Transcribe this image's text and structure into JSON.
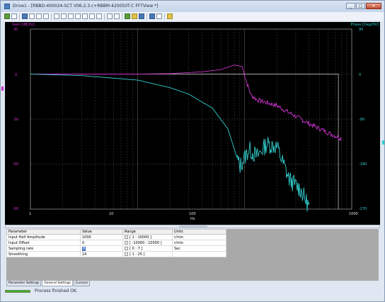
{
  "window": {
    "title": "Drive1 - [RBBD-400024-SCT V06.2.3.c+RBBM-420050T-C FFTView *]",
    "controls": [
      "_",
      "□",
      "✕"
    ]
  },
  "toolbar": {
    "icons": [
      "filter-icon",
      "filter-clear-icon",
      "save-icon",
      "new-icon",
      "copy-icon",
      "paste-icon",
      "print-icon",
      "zoom-in-icon",
      "zoom-out-icon",
      "zoom-window-icon",
      "zoom-x-icon",
      "zoom-y-icon",
      "zoom-fit-icon",
      "pan-icon",
      "crosshair-icon",
      "chart-export-icon",
      "open-icon",
      "save-plot-icon",
      "settings-icon",
      "grid-icon",
      "help-icon"
    ]
  },
  "plot": {
    "left_axis_title": "Gain [dB/Hz]",
    "right_axis_title": "Phase [Deg/OV]",
    "x_ticks": [
      "1",
      "10",
      "100",
      "1000"
    ],
    "x_unit": "Hz",
    "left_ticks": [
      "30",
      "0",
      "-30",
      "-60",
      "-90"
    ],
    "right_ticks": [
      "90",
      "0",
      "-90",
      "-180",
      "-270"
    ],
    "gain_color": "#cc33cc",
    "phase_color": "#33cccc",
    "chart_data": {
      "type": "line",
      "x_scale": "log",
      "xlim": [
        1,
        1000
      ],
      "ylim_left": [
        -90,
        30
      ],
      "ylim_right": [
        -270,
        90
      ],
      "series": [
        {
          "axis": "left",
          "x": [
            1,
            3,
            10,
            20,
            40,
            60,
            80,
            95,
            105,
            115,
            130,
            160,
            200,
            280,
            400,
            600,
            800
          ],
          "y": [
            0,
            0,
            0,
            0.3,
            1.5,
            3,
            6,
            5,
            -6,
            -14,
            -17,
            -19,
            -21,
            -27,
            -33,
            -39,
            -43
          ]
        },
        {
          "axis": "right",
          "x": [
            1,
            3,
            10,
            20,
            30,
            50,
            70,
            90,
            110,
            130,
            160,
            200,
            260,
            330,
            400
          ],
          "y": [
            0,
            -3,
            -12,
            -27,
            -40,
            -68,
            -110,
            -185,
            -150,
            -165,
            -140,
            -145,
            -210,
            -230,
            -265
          ]
        }
      ]
    }
  },
  "params": {
    "headers": [
      "Parameter",
      "Value",
      "Range",
      "Units"
    ],
    "rows": [
      {
        "name": "Input Half Amplitude",
        "value": "1000",
        "range": "[ 1 : 10000 ]",
        "units": "r/min"
      },
      {
        "name": "Input Offset",
        "value": "0",
        "range": "[ -10000 : 10000 ]",
        "units": "r/min"
      },
      {
        "name": "Sampling rate",
        "value": "8",
        "range": "[ 0 : 7 ]",
        "units": "Sec"
      },
      {
        "name": "Smoothing",
        "value": "14",
        "range": "[ 1 : 25 ]",
        "units": ""
      }
    ]
  },
  "tabs": [
    "Parameter Settings",
    "General Settings",
    "Cursors"
  ],
  "status": {
    "text": "Process finished OK.",
    "progress": 1.0
  }
}
